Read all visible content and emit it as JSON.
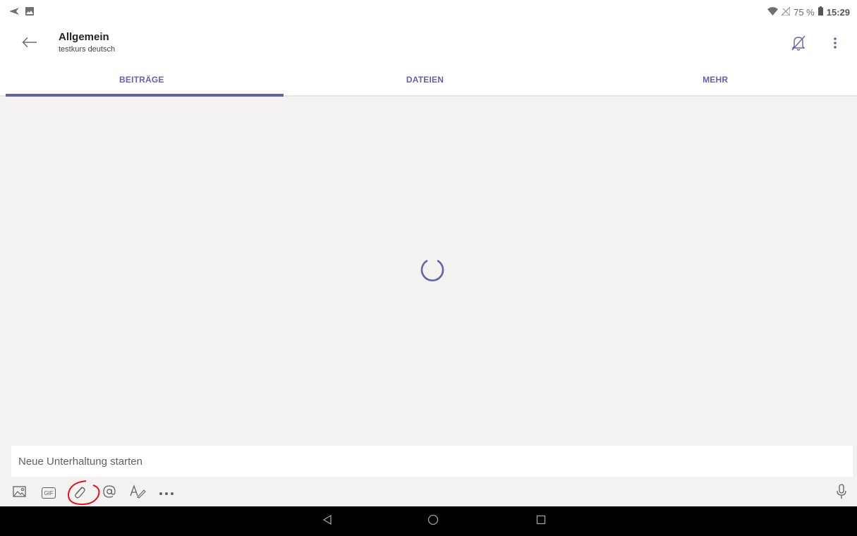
{
  "status_bar": {
    "battery_percent": "75 %",
    "time": "15:29"
  },
  "header": {
    "title": "Allgemein",
    "subtitle": "testkurs deutsch",
    "icons": [
      "back-arrow-icon",
      "bell-off-icon",
      "more-vertical-icon"
    ]
  },
  "tabs": [
    {
      "label": "BEITRÄGE",
      "active": true
    },
    {
      "label": "DATEIEN",
      "active": false
    },
    {
      "label": "MEHR",
      "active": false
    }
  ],
  "compose": {
    "placeholder": "Neue Unterhaltung starten",
    "toolbar_icons": [
      "image-icon",
      "gif-icon",
      "attach-icon",
      "mention-icon",
      "format-icon",
      "more-horizontal-icon",
      "microphone-icon"
    ],
    "gif_label": "GIF"
  },
  "colors": {
    "accent": "#6264a7",
    "background": "#f3f2f1",
    "annotation": "#e0141e"
  }
}
